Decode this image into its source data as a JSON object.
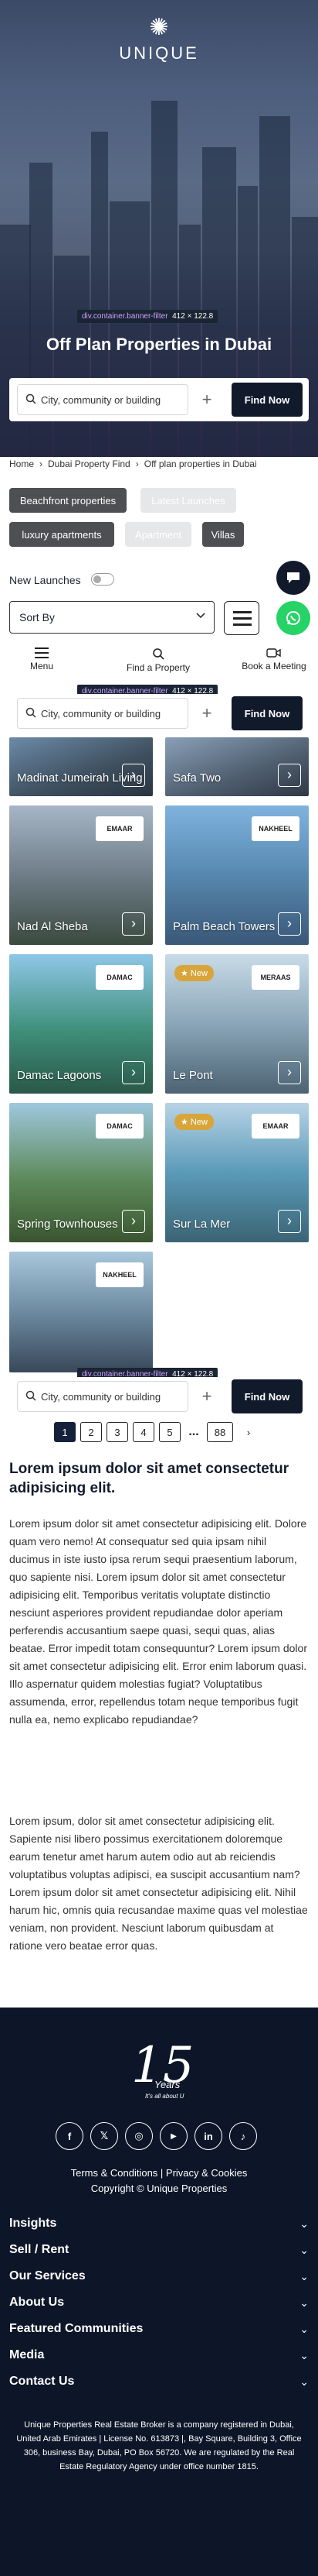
{
  "brand": {
    "name": "UNIQUE"
  },
  "dev_tags": {
    "banner_filter": {
      "selector": "div.container.banner-filter",
      "size": "412 × 122.8"
    }
  },
  "hero": {
    "title": "Off Plan Properties in Dubai"
  },
  "search": {
    "placeholder": "City, community or building",
    "plus": "+",
    "find_label": "Find Now"
  },
  "breadcrumb": [
    "Home",
    "Dubai Property Find",
    "Off plan properties in Dubai"
  ],
  "filters": [
    {
      "label": "Beachfront properties",
      "style": "dark"
    },
    {
      "label": "Latest Launches",
      "style": "light"
    },
    {
      "label": "luxury apartments",
      "style": "dark"
    },
    {
      "label": "Apartment",
      "style": "light"
    },
    {
      "label": "Villas",
      "style": "dark"
    }
  ],
  "new_launches": {
    "label": "New Launches"
  },
  "sort": {
    "label": "Sort By"
  },
  "nav": [
    {
      "label": "Menu",
      "icon": "hamburger-icon"
    },
    {
      "label": "Find a Property",
      "icon": "search-icon"
    },
    {
      "label": "Book a Meeting",
      "icon": "video-icon"
    }
  ],
  "cards": [
    {
      "name": "Madinat Jumeirah Living",
      "brand": "",
      "is_new": false
    },
    {
      "name": "Safa Two",
      "brand": "",
      "is_new": false
    },
    {
      "name": "Nad Al Sheba",
      "brand": "EMAAR",
      "is_new": false
    },
    {
      "name": "Palm Beach Towers",
      "brand": "NAKHEEL",
      "is_new": false
    },
    {
      "name": "Damac Lagoons",
      "brand": "DAMAC",
      "is_new": false
    },
    {
      "name": "Le Pont",
      "brand": "MERAAS",
      "is_new": true
    },
    {
      "name": "Spring Townhouses",
      "brand": "DAMAC",
      "is_new": false
    },
    {
      "name": "Sur La Mer",
      "brand": "EMAAR",
      "is_new": true
    },
    {
      "name": "",
      "brand": "NAKHEEL",
      "is_new": false
    }
  ],
  "new_badge": "New",
  "pagination": {
    "pages": [
      "1",
      "2",
      "3",
      "4",
      "5"
    ],
    "ellipsis": "...",
    "last": "88",
    "next": "›",
    "current": "1"
  },
  "article": {
    "heading": "Lorem ipsum dolor sit amet consectetur adipisicing elit.",
    "p1": "Lorem ipsum dolor sit amet consectetur adipisicing elit. Dolore quam vero nemo! At consequatur sed quia ipsam nihil ducimus in iste iusto ipsa rerum sequi praesentium laborum, quo sapiente nisi. Lorem ipsum dolor sit amet consectetur adipisicing elit. Temporibus veritatis voluptate distinctio nesciunt asperiores provident repudiandae dolor aperiam perferendis accusantium saepe quasi, sequi quas, alias beatae. Error impedit totam consequuntur? Lorem ipsum dolor sit amet consectetur adipisicing elit. Error enim laborum quasi. Illo aspernatur quidem molestias fugiat? Voluptatibus assumenda, error, repellendus totam neque temporibus fugit nulla ea, nemo explicabo repudiandae?",
    "p2": "Lorem ipsum, dolor sit amet consectetur adipisicing elit. Sapiente nisi libero possimus exercitationem doloremque earum tenetur amet harum autem odio aut ab reiciendis voluptatibus voluptas adipisci, ea suscipit accusantium nam? Lorem ipsum dolor sit amet consectetur adipisicing elit. Nihil harum hic, omnis quia recusandae maxime quas vel molestiae veniam, non provident. Nesciunt laborum quibusdam at ratione vero beatae error quas."
  },
  "footer": {
    "anniversary_number": "15",
    "anniversary_word": "Years",
    "anniversary_tagline": "It's all about U",
    "social": [
      {
        "label": "f",
        "icon": "facebook-icon"
      },
      {
        "label": "𝕏",
        "icon": "x-icon"
      },
      {
        "label": "◎",
        "icon": "instagram-icon"
      },
      {
        "label": "▶",
        "icon": "youtube-icon"
      },
      {
        "label": "in",
        "icon": "linkedin-icon"
      },
      {
        "label": "♪",
        "icon": "tiktok-icon"
      }
    ],
    "links": "Terms & Conditions | Privacy & Cookies",
    "copyright": "Copyright © Unique Properties",
    "menu": [
      "Insights",
      "Sell / Rent",
      "Our Services",
      "About Us",
      "Featured Communities",
      "Media",
      "Contact Us"
    ],
    "legal": "Unique Properties Real Estate Broker is a company registered in Dubai, United Arab Emirates | License No. 613873 |, Bay Square, Building 3, Office 306, business Bay, Dubai, PO Box 56720. We are regulated by the Real Estate Regulatory Agency under office number 1815."
  },
  "colors": {
    "navy": "#0d1628",
    "button": "#111a2b",
    "whatsapp": "#25d366",
    "new_badge": "#d8a53a"
  }
}
